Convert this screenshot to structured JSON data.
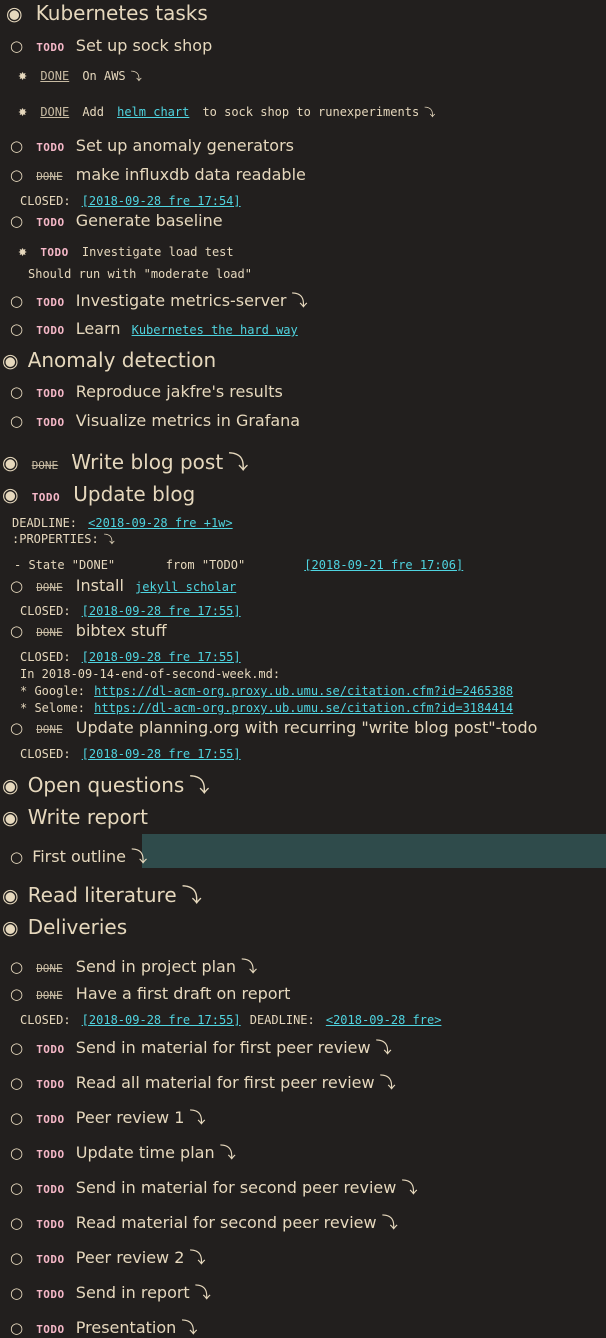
{
  "bullets": {
    "h1": "◉",
    "h2": "○",
    "h3": "✸",
    "fold": "⤵"
  },
  "kw": {
    "todo": "TODO",
    "done": "DONE"
  },
  "closed": "CLOSED:",
  "deadline": "DEADLINE:",
  "properties": ":PROPERTIES:",
  "k8s": {
    "title": "Kubernetes tasks",
    "sock": "Set up sock shop",
    "aws": "On AWS",
    "helm_pre": "Add",
    "helm_link": "helm chart",
    "helm_post": "to sock shop to runexperiments",
    "anomaly_gen": "Set up anomaly generators",
    "influx": "make influxdb data readable",
    "influx_closed": "[2018-09-28 fre 17:54]",
    "baseline": "Generate baseline",
    "load": "Investigate load test",
    "load_note": "Should run with \"moderate load\"",
    "metrics": "Investigate metrics-server",
    "learn": "Learn",
    "learn_link": "Kubernetes the hard way"
  },
  "anomaly": {
    "title": "Anomaly detection",
    "reproduce": "Reproduce jakfre's results",
    "visualize": "Visualize metrics in Grafana"
  },
  "blog": {
    "title": "Write blog post"
  },
  "update": {
    "title": "Update blog",
    "deadline": "<2018-09-28 fre +1w>",
    "state_line": "- State \"DONE\"       from \"TODO\"",
    "state_ts": "[2018-09-21 fre 17:06]",
    "install": "Install",
    "install_link": "jekyll scholar",
    "install_closed": "[2018-09-28 fre 17:55]",
    "bibtex": "bibtex stuff",
    "bibtex_closed": "[2018-09-28 fre 17:55]",
    "in_file": "In 2018-09-14-end-of-second-week.md:",
    "google_label": "* Google:",
    "google_url": "https://dl-acm-org.proxy.ub.umu.se/citation.cfm?id=2465388",
    "selome_label": "* Selome:",
    "selome_url": "https://dl-acm-org.proxy.ub.umu.se/citation.cfm?id=3184414",
    "planning": "Update planning.org with recurring \"write blog post\"-todo",
    "planning_closed": "[2018-09-28 fre 17:55]"
  },
  "questions": {
    "title": "Open questions"
  },
  "report": {
    "title": "Write report",
    "outline": "First outline"
  },
  "literature": {
    "title": "Read literature"
  },
  "deliveries": {
    "title": "Deliveries",
    "plan": "Send in project plan",
    "draft": "Have a first draft on report",
    "draft_closed": "[2018-09-28 fre 17:55]",
    "draft_deadline": "<2018-09-28 fre>",
    "items": [
      "Send in material for first peer review",
      "Read all material for first peer review",
      "Peer review 1",
      "Update time plan",
      "Send in material for second peer review",
      "Read material for second peer review",
      "Peer review 2",
      "Send in report",
      "Presentation"
    ]
  }
}
